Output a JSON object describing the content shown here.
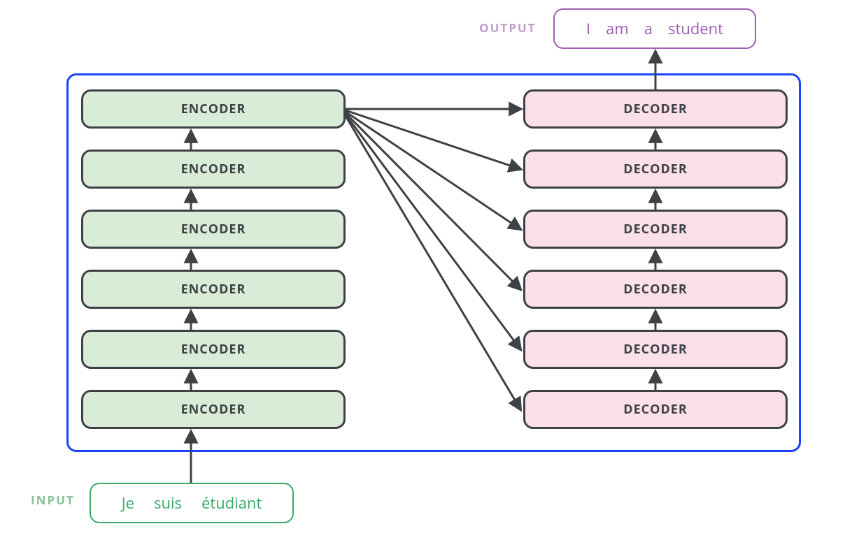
{
  "input": {
    "label": "INPUT",
    "tokens": [
      "Je",
      "suis",
      "étudiant"
    ]
  },
  "output": {
    "label": "OUTPUT",
    "tokens": [
      "I",
      "am",
      "a",
      "student"
    ]
  },
  "encoders": [
    "ENCODER",
    "ENCODER",
    "ENCODER",
    "ENCODER",
    "ENCODER",
    "ENCODER"
  ],
  "decoders": [
    "DECODER",
    "DECODER",
    "DECODER",
    "DECODER",
    "DECODER",
    "DECODER"
  ],
  "colors": {
    "frame": "#1a43ff",
    "encoder_bg": "#d9ecd7",
    "decoder_bg": "#fbdfe9",
    "block_border": "#3e4145",
    "arrow": "#3e4145",
    "input_border": "#3aab67",
    "input_text": "#3aab67",
    "input_label": "#87c398",
    "output_border": "#a15db7",
    "output_text": "#a15db7",
    "output_label": "#c39dcf"
  }
}
